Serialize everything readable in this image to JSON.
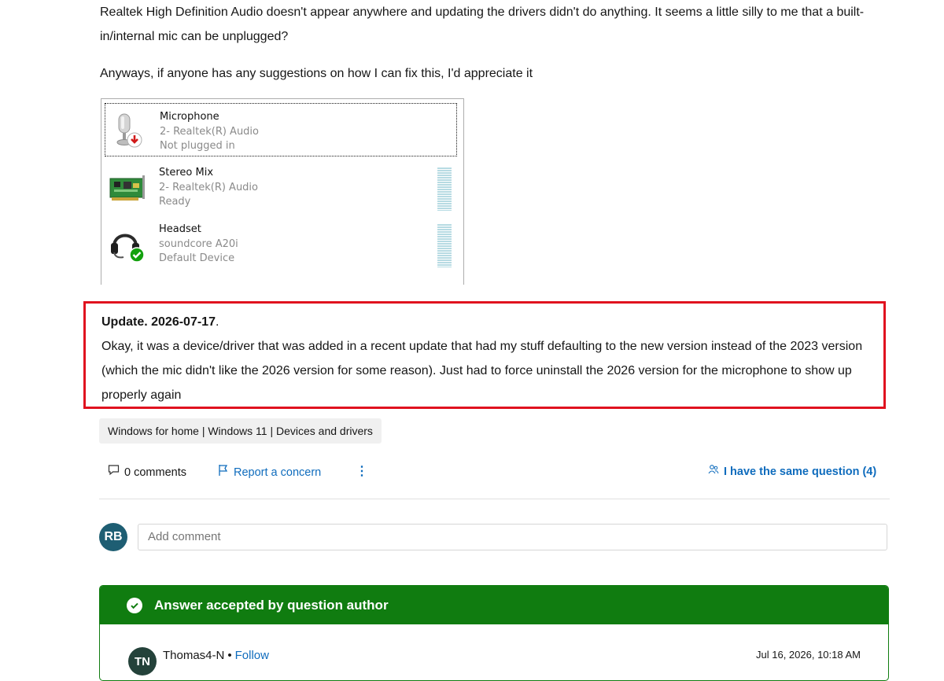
{
  "post": {
    "paragraph1": "Realtek High Definition Audio doesn't appear anywhere and updating the drivers didn't do anything. It seems a little silly to me that a built-in/internal mic can be unplugged?",
    "paragraph2": "Anyways, if anyone has any suggestions on how I can fix this, I'd appreciate it"
  },
  "devices": [
    {
      "name": "Microphone",
      "driver": "2- Realtek(R) Audio",
      "status": "Not plugged in",
      "icon": "microphone-icon",
      "badge": "unplugged-arrow"
    },
    {
      "name": "Stereo Mix",
      "driver": "2- Realtek(R) Audio",
      "status": "Ready",
      "icon": "sound-card-icon"
    },
    {
      "name": "Headset",
      "driver": "soundcore A20i",
      "status": "Default Device",
      "icon": "headset-icon",
      "badge": "default-check"
    }
  ],
  "update": {
    "heading": "Update. 2026-07-17",
    "heading_suffix": ".",
    "body": "Okay, it was a device/driver that was added in a recent update that had my stuff defaulting to the new version instead of the 2023 version (which the mic didn't like the 2026 version for some reason). Just had to force uninstall the 2026 version for the microphone to show up properly again"
  },
  "tag": "Windows for home | Windows 11 | Devices and drivers",
  "actions": {
    "comments": "0 comments",
    "report": "Report a concern",
    "more": "⋮",
    "same_question": "I have the same question (4)"
  },
  "comment_box": {
    "avatar_initials": "RB",
    "placeholder": "Add comment"
  },
  "answer": {
    "banner": "Answer accepted by question author",
    "author_initials": "TN",
    "author": "Thomas4-N",
    "separator": "•",
    "follow": "Follow",
    "date": "Jul 16, 2026, 10:18 AM"
  },
  "colors": {
    "accent_blue": "#0f6cbd",
    "accepted_green": "#107c10",
    "highlight_red": "#e0121f"
  }
}
